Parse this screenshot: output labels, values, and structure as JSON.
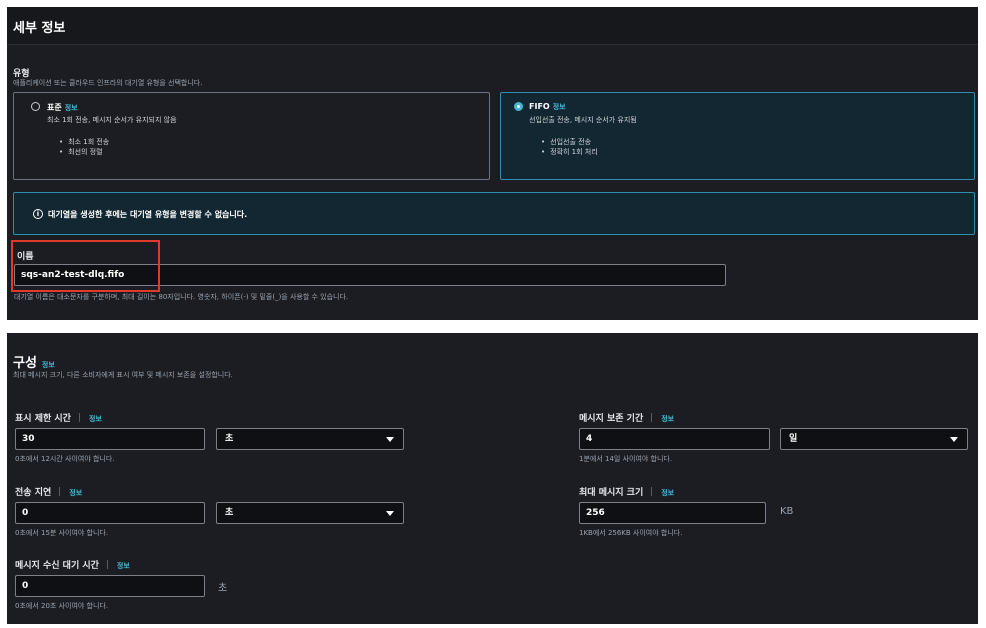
{
  "details": {
    "title": "세부 정보",
    "type_label": "유형",
    "type_desc": "애플리케이션 또는 클라우드 인프라의 대기열 유형을 선택합니다.",
    "options": [
      {
        "title": "표준",
        "info": "정보",
        "desc": "최소 1회 전송, 메시지 순서가 유지되지 않음",
        "bullets": [
          "최소 1회 전송",
          "최선의 정렬"
        ],
        "selected": false
      },
      {
        "title": "FIFO",
        "info": "정보",
        "desc": "선입선출 전송, 메시지 순서가 유지됨",
        "bullets": [
          "선입선출 전송",
          "정확히 1회 처리"
        ],
        "selected": true
      }
    ],
    "alert": "대기열을 생성한 후에는 대기열 유형을 변경할 수 없습니다.",
    "alert_icon": "i",
    "name_label": "이름",
    "name_value": "sqs-an2-test-dlq.fifo",
    "name_hint": "대기열 이름은 대소문자를 구분하며, 최대 길이는 80자입니다. 영숫자, 하이픈(-) 및 밑줄(_)을 사용할 수 있습니다."
  },
  "config": {
    "title": "구성",
    "info": "정보",
    "desc": "최대 메시지 크기, 다른 소비자에게 표시 여부 및 메시지 보존을 설정합니다.",
    "visibility_timeout": {
      "label": "표시 제한 시간",
      "info": "정보",
      "value": "30",
      "unit": "초",
      "hint": "0초에서 12시간 사이여야 합니다."
    },
    "retention": {
      "label": "메시지 보존 기간",
      "info": "정보",
      "value": "4",
      "unit": "일",
      "hint": "1분에서 14일 사이여야 합니다."
    },
    "delay": {
      "label": "전송 지연",
      "info": "정보",
      "value": "0",
      "unit": "초",
      "hint": "0초에서 15분 사이여야 합니다."
    },
    "max_size": {
      "label": "최대 메시지 크기",
      "info": "정보",
      "value": "256",
      "unit": "KB",
      "hint": "1KB에서 256KB 사이여야 합니다."
    },
    "receive_wait": {
      "label": "메시지 수신 대기 시간",
      "info": "정보",
      "value": "0",
      "unit": "초",
      "hint": "0초에서 20초 사이여야 합니다."
    }
  },
  "colors": {
    "accent": "#44b9d6",
    "highlight": "#e03a2b",
    "panel": "#1b1d22"
  }
}
